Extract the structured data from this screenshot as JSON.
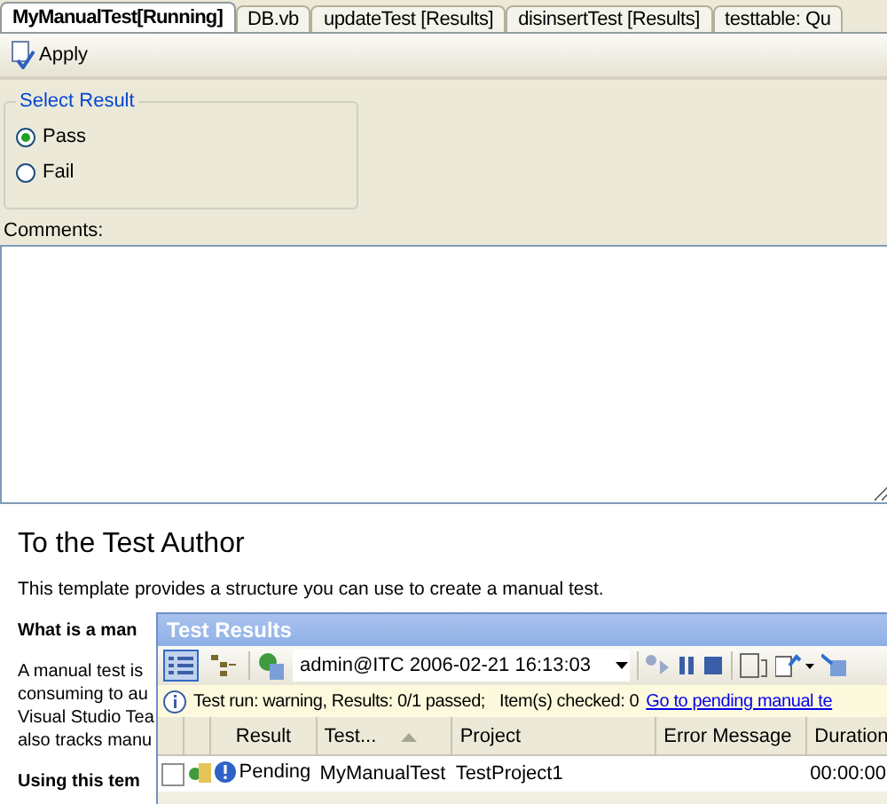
{
  "tabs": [
    {
      "label": "MyManualTest[Running]",
      "selected": true
    },
    {
      "label": "DB.vb",
      "selected": false
    },
    {
      "label": "updateTest [Results]",
      "selected": false
    },
    {
      "label": "disinsertTest [Results]",
      "selected": false
    },
    {
      "label": "testtable: Qu",
      "selected": false
    }
  ],
  "toolbar": {
    "apply": "Apply"
  },
  "select_result": {
    "title": "Select Result",
    "options": [
      {
        "label": "Pass",
        "selected": true
      },
      {
        "label": "Fail",
        "selected": false
      }
    ]
  },
  "comments": {
    "label": "Comments:"
  },
  "document": {
    "heading": "To the Test Author",
    "paragraphs": [
      {
        "kind": "text",
        "lines": [
          "This template provides a structure you can use to create a manual test."
        ]
      },
      {
        "kind": "bold",
        "lines": [
          "What is a man"
        ]
      },
      {
        "kind": "text",
        "lines": [
          "A manual test is",
          "consuming to au",
          "Visual Studio Tea",
          "also tracks manu"
        ]
      },
      {
        "kind": "bold",
        "lines": [
          "Using this tem"
        ]
      }
    ]
  },
  "test_results": {
    "title": "Test Results",
    "run": "admin@ITC 2006-02-21 16:13:03",
    "status": "Test run: warning, Results: 0/1 passed;",
    "checked": "Item(s) checked: 0",
    "link": "Go to pending manual te",
    "columns": [
      "Result",
      "Test...",
      "Project",
      "Error Message",
      "Duration"
    ],
    "rows": [
      {
        "checked": false,
        "result": "Pending",
        "test": "MyManualTest",
        "project": "TestProject1",
        "duration": "00:00:00"
      }
    ]
  }
}
